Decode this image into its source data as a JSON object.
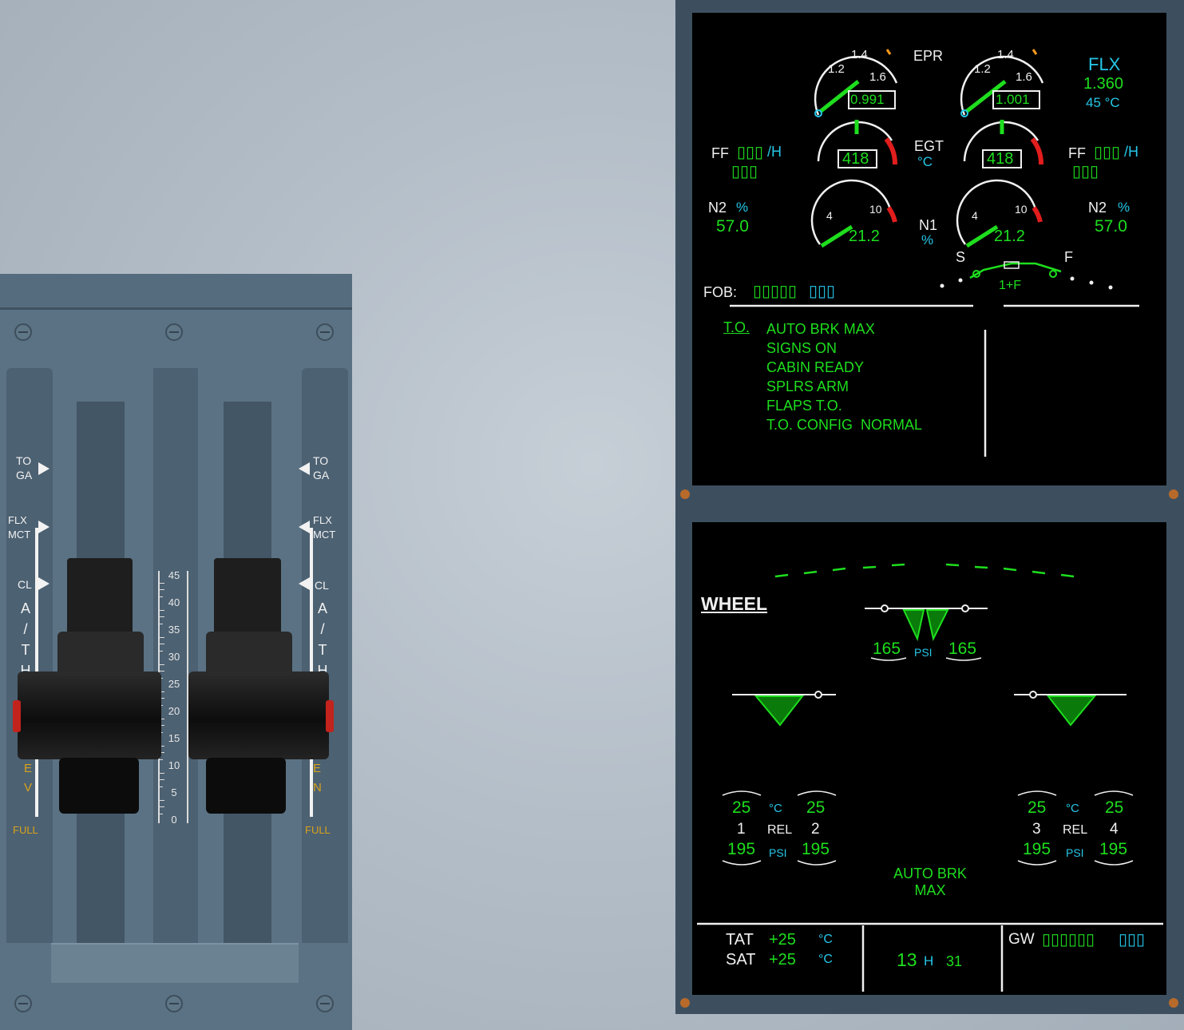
{
  "throttle": {
    "left_detents": [
      "TO",
      "GA",
      "FLX",
      "MCT",
      "CL"
    ],
    "right_detents": [
      "TO",
      "GA",
      "FLX",
      "MCT",
      "CL"
    ],
    "athr_letters": [
      "A",
      "/",
      "T",
      "H"
    ],
    "reverse_letters": [
      "E",
      "V"
    ],
    "right_reverse_letters": [
      "E",
      "N"
    ],
    "full_label": "FULL",
    "scale_ticks": [
      "45",
      "40",
      "35",
      "30",
      "25",
      "20",
      "15",
      "10",
      "5",
      "0"
    ]
  },
  "ewd": {
    "epr_label": "EPR",
    "eng1": {
      "epr_ticks": [
        "1.2",
        "1.4",
        "1.6"
      ],
      "epr_value": "0.991",
      "egt_value": "418",
      "n1_ticks": [
        "4",
        "10"
      ],
      "n1_value": "21.2",
      "ff_label": "FF",
      "ff_dashes": "▯▯▯",
      "ff_unit": "/H",
      "ff_value": "▯▯▯",
      "n2_label": "N2",
      "n2_unit": "%",
      "n2_value": "57.0"
    },
    "eng2": {
      "epr_ticks": [
        "1.2",
        "1.4",
        "1.6"
      ],
      "epr_value": "1.001",
      "egt_value": "418",
      "n1_ticks": [
        "4",
        "10"
      ],
      "n1_value": "21.2",
      "ff_label": "FF",
      "ff_dashes": "▯▯▯",
      "ff_unit": "/H",
      "ff_value": "▯▯▯",
      "n2_label": "N2",
      "n2_unit": "%",
      "n2_value": "57.0"
    },
    "flx": {
      "label": "FLX",
      "epr": "1.360",
      "temp": "45 °C"
    },
    "egt_label": "EGT",
    "egt_unit": "°C",
    "n1_label": "N1",
    "n1_unit": "%",
    "fob_label": "FOB:",
    "fob_value": "▯▯▯▯▯",
    "fob_unit": "▯▯▯",
    "slats_label": "S",
    "flaps_label": "F",
    "flap_config": "1+F",
    "memo": {
      "title": "T.O.",
      "lines": [
        "AUTO BRK MAX",
        "SIGNS ON",
        "CABIN READY",
        "SPLRS ARM",
        "FLAPS T.O.",
        "T.O. CONFIG  NORMAL"
      ]
    }
  },
  "sd": {
    "page_title": "WHEEL",
    "nose_psi_left": "165",
    "nose_psi_right": "165",
    "psi_unit": "PSI",
    "left_gear": {
      "temp1": "25",
      "temp2": "25",
      "wheel1": "1",
      "wheel2": "2",
      "rel": "REL",
      "temp_unit": "°C",
      "psi1": "195",
      "psi2": "195",
      "psi_unit": "PSI"
    },
    "right_gear": {
      "temp1": "25",
      "temp2": "25",
      "wheel1": "3",
      "wheel2": "4",
      "rel": "REL",
      "temp_unit": "°C",
      "psi1": "195",
      "psi2": "195",
      "psi_unit": "PSI"
    },
    "autobrk": {
      "label": "AUTO BRK",
      "mode": "MAX"
    },
    "tat": {
      "label": "TAT",
      "value": "+25",
      "unit": "°C"
    },
    "sat": {
      "label": "SAT",
      "value": "+25",
      "unit": "°C"
    },
    "time": {
      "hours": "13",
      "h": "H",
      "minutes": "31"
    },
    "gw": {
      "label": "GW",
      "value": "▯▯▯▯▯▯",
      "unit": "▯▯▯"
    }
  },
  "colors": {
    "green": "#1ede1e",
    "cyan": "#25c7e8",
    "amber": "#ff9a1a",
    "red": "#e21d1d",
    "white": "#f0f0f0"
  }
}
